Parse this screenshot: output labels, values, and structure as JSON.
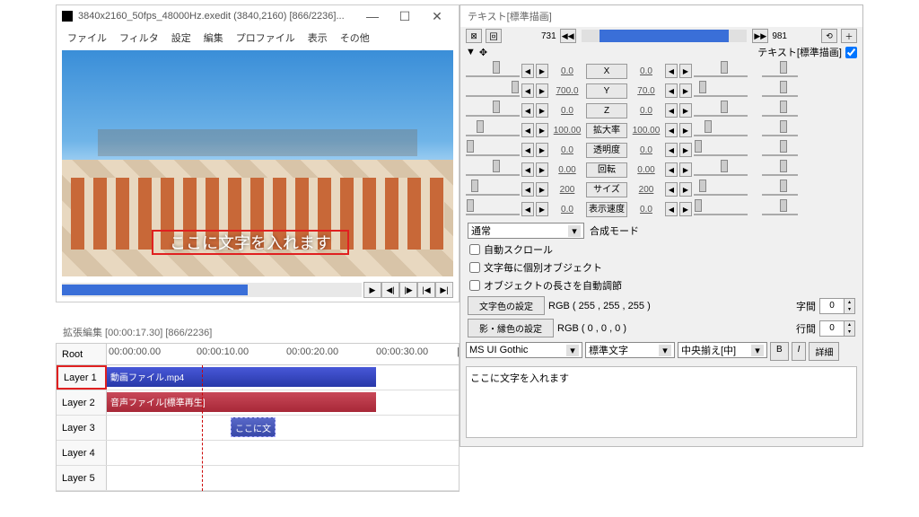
{
  "main": {
    "title": "3840x2160_50fps_48000Hz.exedit (3840,2160)  [866/2236]...",
    "menus": [
      "ファイル",
      "フィルタ",
      "設定",
      "編集",
      "プロファイル",
      "表示",
      "その他"
    ],
    "overlay": "ここに文字を入れます",
    "play": {
      "p": "▶",
      "sl": "◀|",
      "sr": "|▶",
      "first": "|◀",
      "last": "▶|"
    }
  },
  "timeline": {
    "header": "拡張編集 [00:00:17.30] [866/2236]",
    "root": "Root",
    "times": [
      "00:00:00.00",
      "00:00:10.00",
      "00:00:20.00",
      "00:00:30.00"
    ],
    "layers": [
      "Layer 1",
      "Layer 2",
      "Layer 3",
      "Layer 4",
      "Layer 5"
    ],
    "clips": {
      "video": "動画ファイル.mp4",
      "audio": "音声ファイル[標準再生]",
      "text": "ここに文"
    }
  },
  "props": {
    "title": "テキスト[標準描画]",
    "frame_l": "731",
    "frame_r": "981",
    "tag": "テキスト[標準描画]",
    "params": [
      {
        "label": "X",
        "v1": "0.0",
        "v2": "0.0",
        "k1": 50,
        "k2": 50
      },
      {
        "label": "Y",
        "v1": "700.0",
        "v2": "70.0",
        "k1": 85,
        "k2": 10
      },
      {
        "label": "Z",
        "v1": "0.0",
        "v2": "0.0",
        "k1": 50,
        "k2": 50
      },
      {
        "label": "拡大率",
        "v1": "100.00",
        "v2": "100.00",
        "k1": 20,
        "k2": 20
      },
      {
        "label": "透明度",
        "v1": "0.0",
        "v2": "0.0",
        "k1": 2,
        "k2": 2
      },
      {
        "label": "回転",
        "v1": "0.00",
        "v2": "0.00",
        "k1": 50,
        "k2": 50
      },
      {
        "label": "サイズ",
        "v1": "200",
        "v2": "200",
        "k1": 10,
        "k2": 10
      },
      {
        "label": "表示速度",
        "v1": "0.0",
        "v2": "0.0",
        "k1": 2,
        "k2": 2
      }
    ],
    "blend_combo": "通常",
    "blend_label": "合成モード",
    "checks": [
      "自動スクロール",
      "文字毎に個別オブジェクト",
      "オブジェクトの長さを自動調節"
    ],
    "colorbtn": "文字色の設定",
    "colorval": "RGB ( 255 , 255 , 255 )",
    "shadowbtn": "影・縁色の設定",
    "shadowval": "RGB ( 0 , 0 , 0 )",
    "spacing": "字間",
    "linesp": "行間",
    "sp1": "0",
    "sp2": "0",
    "font": "MS UI Gothic",
    "weight": "標準文字",
    "align": "中央揃え[中]",
    "b": "B",
    "i": "I",
    "detail": "詳細",
    "text": "ここに文字を入れます"
  }
}
